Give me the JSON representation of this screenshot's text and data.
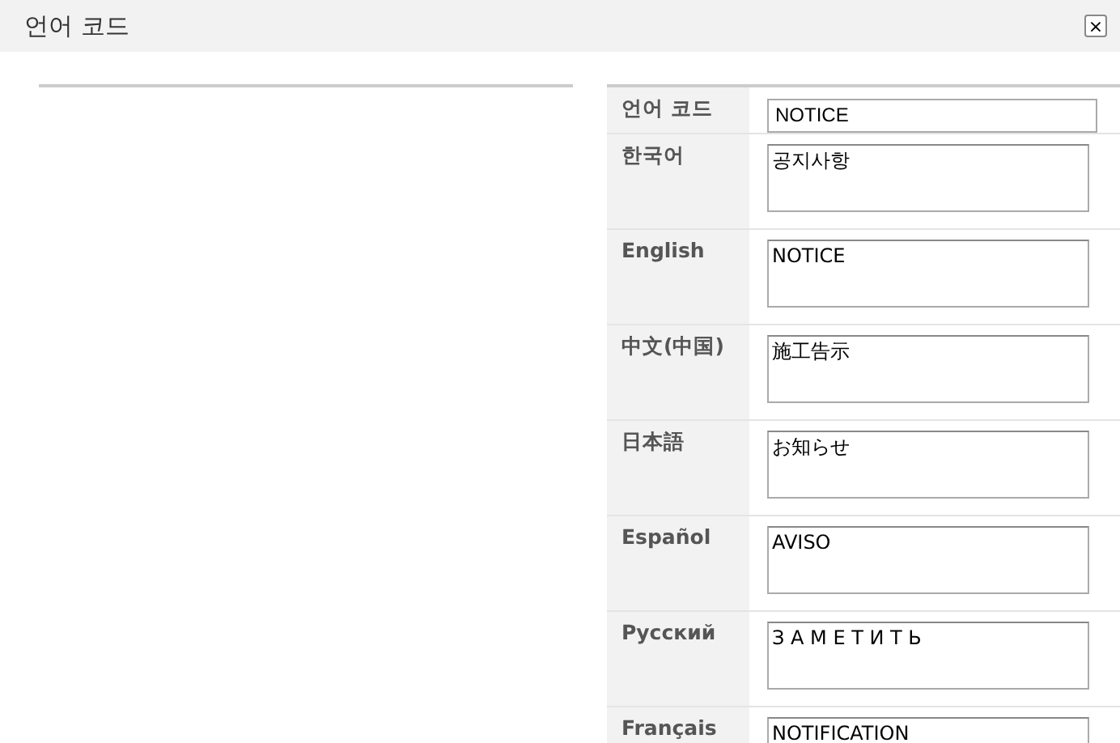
{
  "window": {
    "title": "언어 코드",
    "close": "×"
  },
  "code_row": {
    "label": "언어 코드",
    "value": "NOTICE"
  },
  "translations": [
    {
      "label": "한국어",
      "value": "공지사항"
    },
    {
      "label": "English",
      "value": "NOTICE"
    },
    {
      "label": "中文(中国)",
      "value": "施工告示"
    },
    {
      "label": "日本語",
      "value": "お知らせ"
    },
    {
      "label": "Español",
      "value": "AVISO"
    },
    {
      "label": "Русский",
      "value": "З А М Е Т И Т Ь"
    },
    {
      "label": "Français",
      "value": "NOTIFICATION"
    }
  ]
}
